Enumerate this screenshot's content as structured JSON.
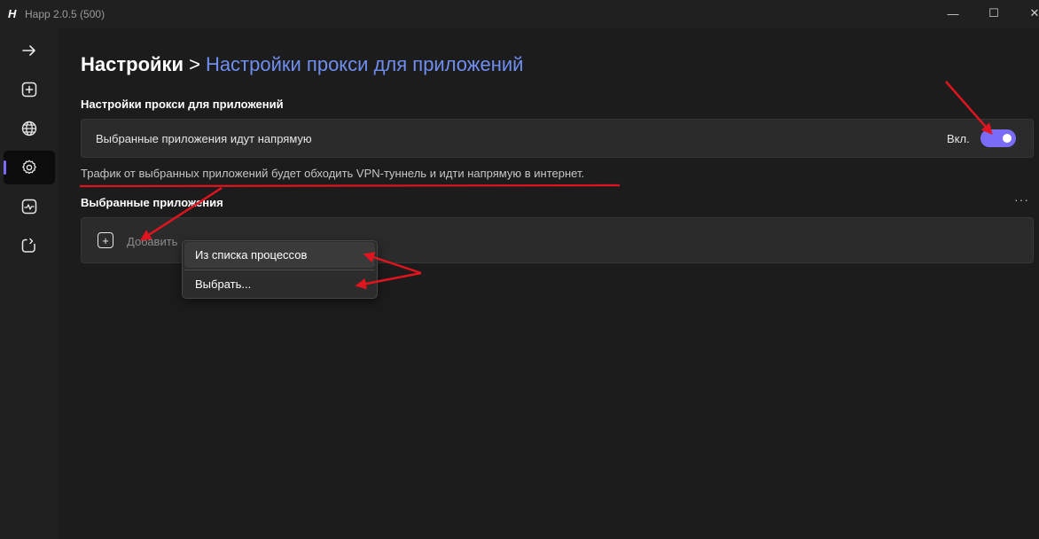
{
  "window": {
    "logo": "H",
    "title": "Happ 2.0.5 (500)",
    "minimize_glyph": "—",
    "maximize_glyph": "☐",
    "close_glyph": "✕"
  },
  "sidebar": {
    "items": [
      {
        "icon": "arrow-right-icon",
        "active": false
      },
      {
        "icon": "add-square-icon",
        "active": false
      },
      {
        "icon": "globe-icon",
        "active": false
      },
      {
        "icon": "gear-icon",
        "active": true
      },
      {
        "icon": "activity-icon",
        "active": false
      },
      {
        "icon": "power-icon",
        "active": false
      }
    ],
    "accent": "#7a6cf7"
  },
  "breadcrumb": {
    "root": "Настройки",
    "separator": ">",
    "current": "Настройки прокси для приложений"
  },
  "proxy_section": {
    "title": "Настройки прокси для приложений",
    "row_label": "Выбранные приложения идут напрямую",
    "toggle_state": "Вкл.",
    "toggle_on": true,
    "description": "Трафик от выбранных приложений будет обходить VPN-туннель и идти напрямую в интернет."
  },
  "apps_section": {
    "title": "Выбранные приложения",
    "more_glyph": "···",
    "add_glyph": "+",
    "add_label": "Добавить"
  },
  "context_menu": {
    "items": [
      {
        "label": "Из списка процессов"
      },
      {
        "label": "Выбрать..."
      }
    ]
  },
  "colors": {
    "accent": "#7a6cf7",
    "link_blue": "#6f8ef0",
    "annotation_red": "#e0141e"
  }
}
